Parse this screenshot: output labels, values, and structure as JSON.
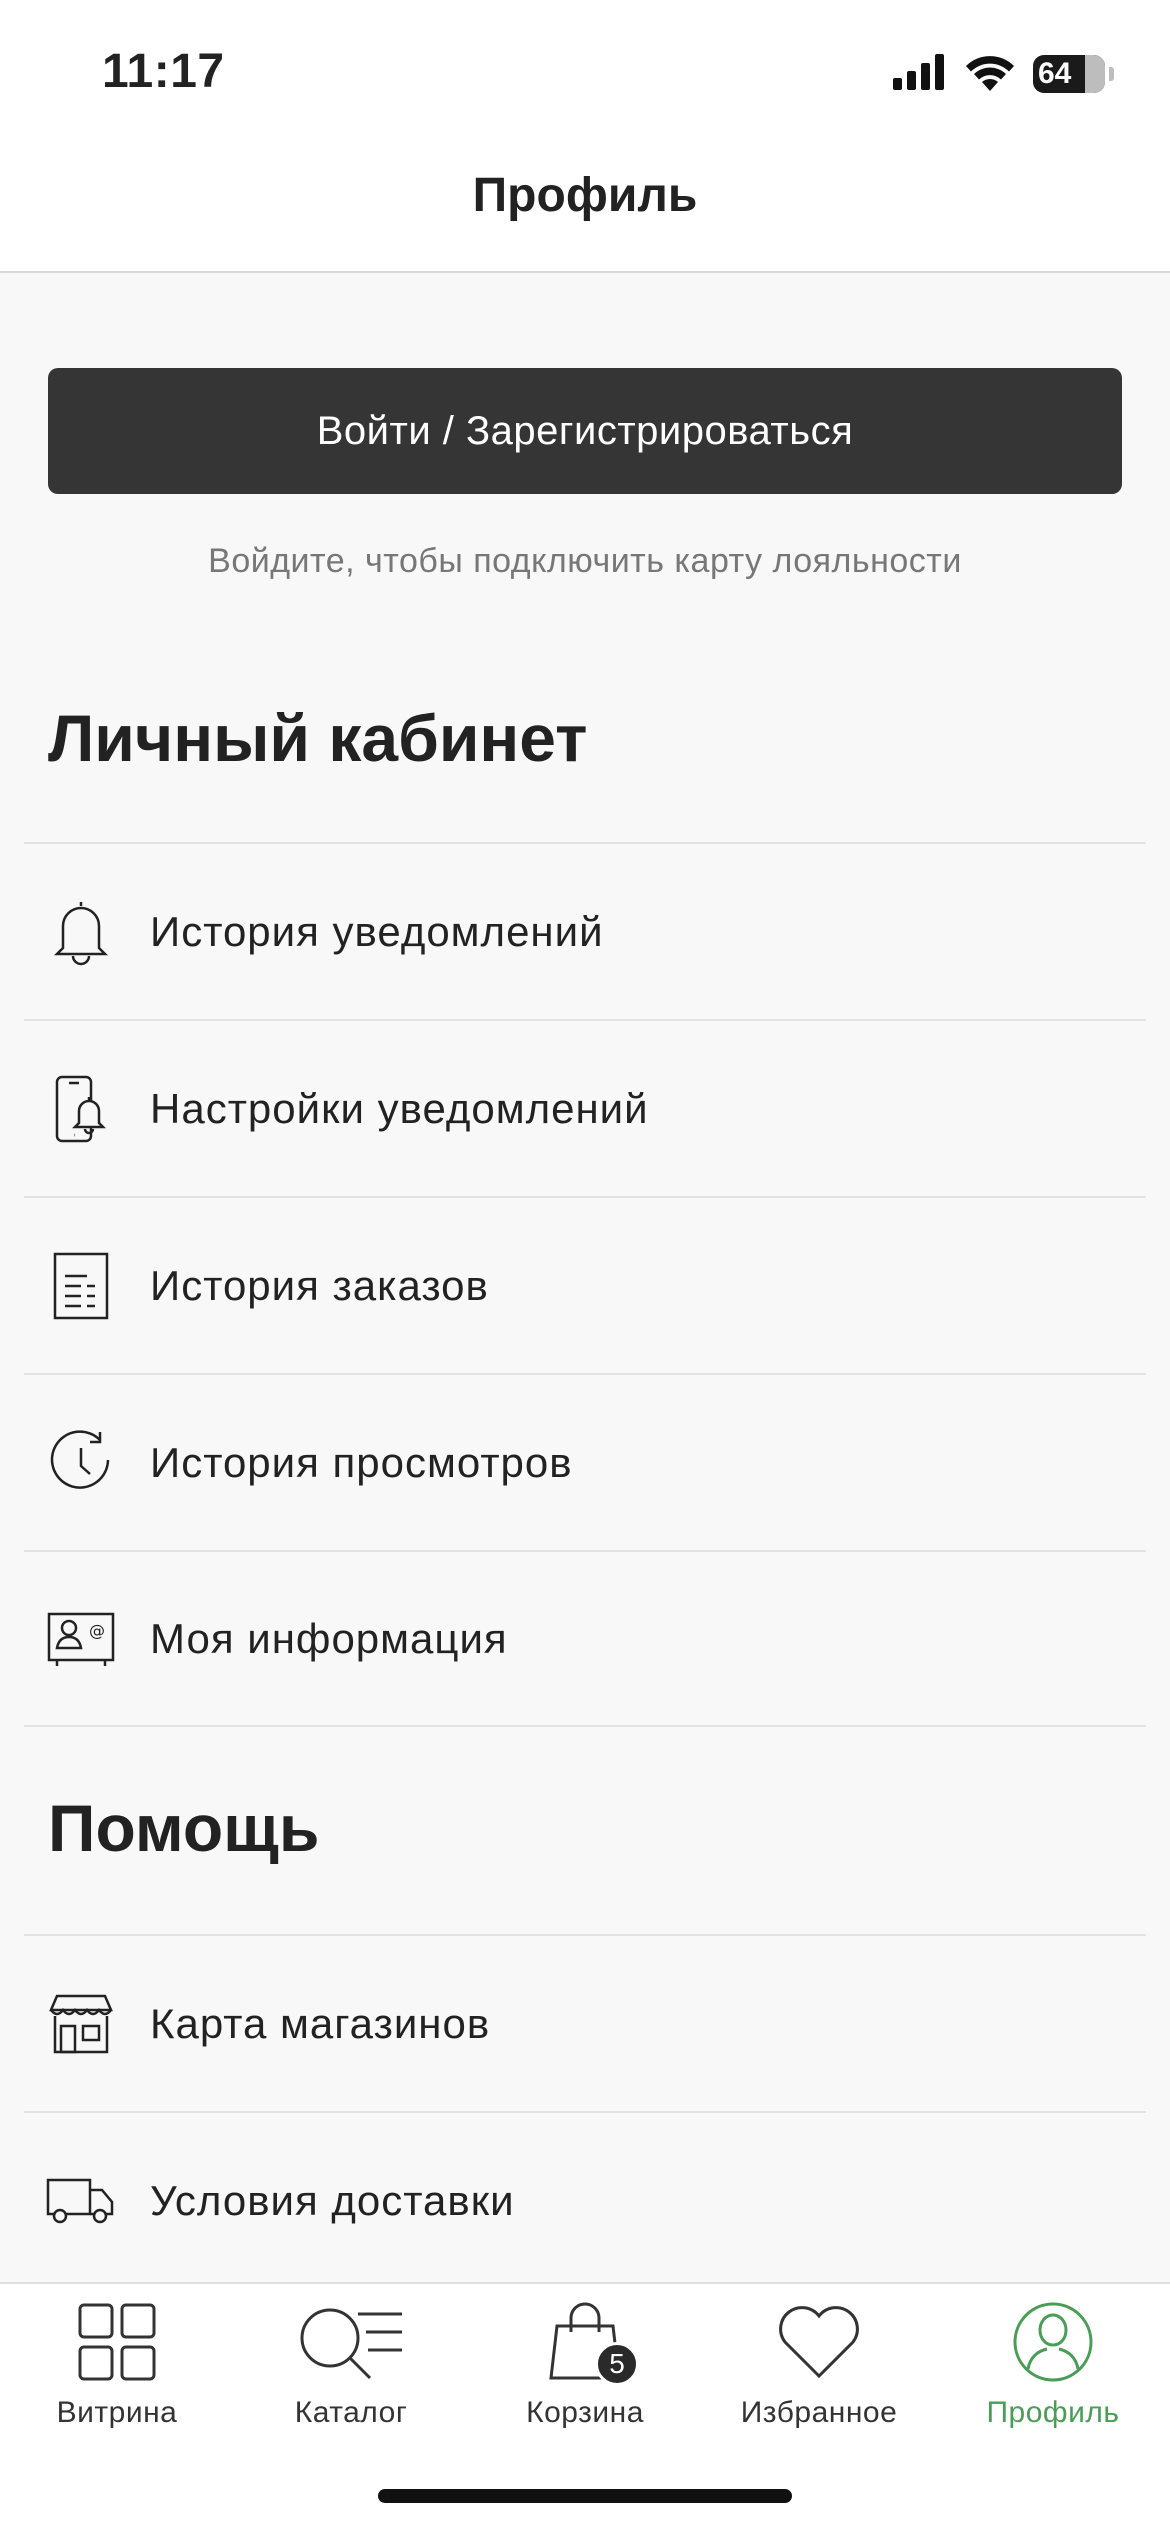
{
  "status_bar": {
    "time": "11:17",
    "battery": "64"
  },
  "header": {
    "title": "Профиль"
  },
  "login": {
    "button_label": "Войти / Зарегистрироваться",
    "hint": "Войдите, чтобы подключить карту лояльности"
  },
  "account": {
    "title": "Личный кабинет",
    "items": [
      {
        "label": "История уведомлений",
        "icon": "bell-icon"
      },
      {
        "label": "Настройки уведомлений",
        "icon": "phone-bell-icon"
      },
      {
        "label": "История заказов",
        "icon": "receipt-icon"
      },
      {
        "label": "История просмотров",
        "icon": "clock-icon"
      },
      {
        "label": "Моя информация",
        "icon": "contact-card-icon"
      }
    ]
  },
  "help": {
    "title": "Помощь",
    "items": [
      {
        "label": "Карта магазинов",
        "icon": "store-icon"
      },
      {
        "label": "Условия доставки",
        "icon": "truck-icon"
      }
    ]
  },
  "tab_bar": {
    "active_color": "#4a9d57",
    "tabs": [
      {
        "label": "Витрина",
        "icon": "grid-icon"
      },
      {
        "label": "Каталог",
        "icon": "catalog-search-icon"
      },
      {
        "label": "Корзина",
        "icon": "shopping-bag-icon",
        "badge": "5"
      },
      {
        "label": "Избранное",
        "icon": "heart-icon"
      },
      {
        "label": "Профиль",
        "icon": "profile-icon",
        "active": true
      }
    ]
  }
}
